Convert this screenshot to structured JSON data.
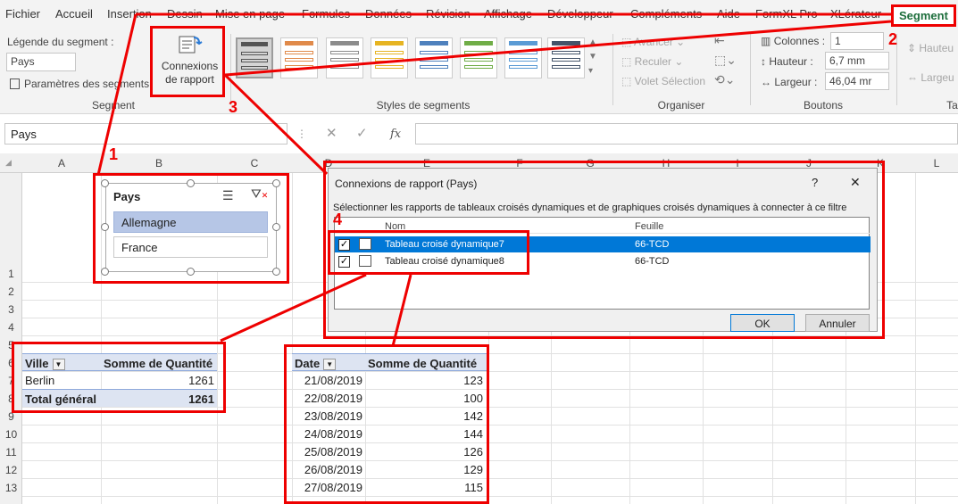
{
  "ribbon_tabs": [
    "Fichier",
    "Accueil",
    "Insertion",
    "Dessin",
    "Mise en page",
    "Formules",
    "Données",
    "Révision",
    "Affichage",
    "Développeur",
    "Compléments",
    "Aide",
    "FormXL Pro",
    "XLérateur",
    "Segment"
  ],
  "active_tab": "Segment",
  "segment_group": {
    "caption_label": "Légende du segment :",
    "caption_value": "Pays",
    "settings_label": "Paramètres des segments",
    "title": "Segment"
  },
  "report_connections": {
    "line1": "Connexions",
    "line2": "de rapport"
  },
  "styles_group": {
    "title": "Styles de segments"
  },
  "organize_group": {
    "forward": "Avancer",
    "backward": "Reculer",
    "selection_pane": "Volet Sélection",
    "title": "Organiser"
  },
  "buttons_group": {
    "columns_label": "Colonnes :",
    "columns_value": "1",
    "height_label": "Hauteur :",
    "height_value": "6,7 mm",
    "width_label": "Largeur :",
    "width_value": "46,04 mr",
    "title": "Boutons"
  },
  "size_group": {
    "height": "Hauteu",
    "width": "Largeu",
    "title": "Ta"
  },
  "formula_bar": {
    "name_box": "Pays",
    "cancel": "✕",
    "enter": "✓",
    "fx": "fx"
  },
  "columns": [
    "A",
    "B",
    "C",
    "D",
    "E",
    "F",
    "G",
    "H",
    "I",
    "J",
    "K",
    "L"
  ],
  "rows": [
    "1",
    "2",
    "3",
    "4",
    "5",
    "6",
    "7",
    "8",
    "9",
    "10",
    "11",
    "12",
    "13"
  ],
  "slicer": {
    "title": "Pays",
    "items": [
      "Allemagne",
      "France"
    ],
    "selected": "Allemagne"
  },
  "dialog": {
    "title": "Connexions de rapport (Pays)",
    "help": "?",
    "close": "✕",
    "instruction": "Sélectionner les rapports de tableaux croisés dynamiques et de graphiques croisés dynamiques à connecter à ce filtre",
    "col_name": "Nom",
    "col_sheet": "Feuille",
    "rows": [
      {
        "name": "Tableau croisé dynamique7",
        "sheet": "66-TCD",
        "checked": true,
        "selected": true
      },
      {
        "name": "Tableau croisé dynamique8",
        "sheet": "66-TCD",
        "checked": true,
        "selected": false
      }
    ],
    "ok": "OK",
    "cancel": "Annuler"
  },
  "pivot1": {
    "headers": [
      "Ville",
      "Somme de Quantité"
    ],
    "rows": [
      {
        "label": "Berlin",
        "value": "1261"
      }
    ],
    "total_label": "Total général",
    "total_value": "1261"
  },
  "pivot2": {
    "headers": [
      "Date",
      "Somme de Quantité"
    ],
    "rows": [
      {
        "label": "21/08/2019",
        "value": "123"
      },
      {
        "label": "22/08/2019",
        "value": "100"
      },
      {
        "label": "23/08/2019",
        "value": "142"
      },
      {
        "label": "24/08/2019",
        "value": "144"
      },
      {
        "label": "25/08/2019",
        "value": "126"
      },
      {
        "label": "26/08/2019",
        "value": "129"
      },
      {
        "label": "27/08/2019",
        "value": "115"
      }
    ]
  },
  "annotations": [
    "1",
    "2",
    "3",
    "4"
  ],
  "colors": {
    "annotation": "#ee0000",
    "slicer_selected": "#b6c6e6",
    "pivot_header": "#dde4f2",
    "dialog_selection": "#0078d7",
    "segment_tab": "#1e6e3c"
  }
}
